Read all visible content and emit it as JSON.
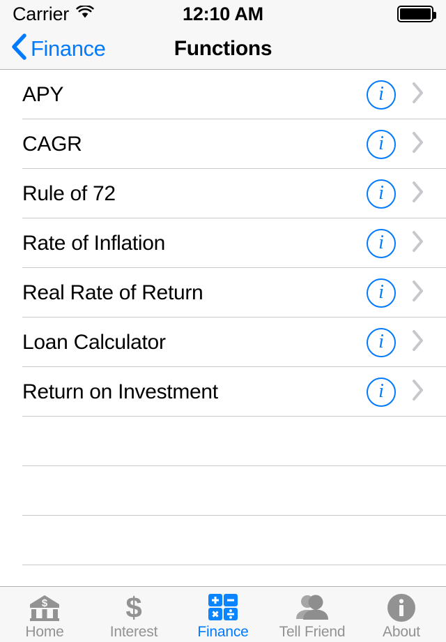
{
  "status_bar": {
    "carrier": "Carrier",
    "wifi_icon": "wifi-icon",
    "time": "12:10 AM",
    "battery_icon": "battery-full-icon",
    "battery_level_percent": 100
  },
  "nav_bar": {
    "back_icon": "chevron-left-icon",
    "back_label": "Finance",
    "title": "Functions",
    "tint_color": "#007aff"
  },
  "list": {
    "rows": [
      {
        "title": "APY",
        "info_icon": "info-circle-icon",
        "disclosure_icon": "chevron-right-icon"
      },
      {
        "title": "CAGR",
        "info_icon": "info-circle-icon",
        "disclosure_icon": "chevron-right-icon"
      },
      {
        "title": "Rule of 72",
        "info_icon": "info-circle-icon",
        "disclosure_icon": "chevron-right-icon"
      },
      {
        "title": "Rate of Inflation",
        "info_icon": "info-circle-icon",
        "disclosure_icon": "chevron-right-icon"
      },
      {
        "title": "Real Rate of Return",
        "info_icon": "info-circle-icon",
        "disclosure_icon": "chevron-right-icon"
      },
      {
        "title": "Loan Calculator",
        "info_icon": "info-circle-icon",
        "disclosure_icon": "chevron-right-icon"
      },
      {
        "title": "Return on Investment",
        "info_icon": "info-circle-icon",
        "disclosure_icon": "chevron-right-icon"
      }
    ],
    "empty_row_count": 3,
    "separator_color": "#c8c7cc"
  },
  "tab_bar": {
    "active_index": 2,
    "active_color": "#007aff",
    "inactive_color": "#929292",
    "items": [
      {
        "label": "Home",
        "icon": "bank-building-icon"
      },
      {
        "label": "Interest",
        "icon": "dollar-sign-icon"
      },
      {
        "label": "Finance",
        "icon": "calculator-icon"
      },
      {
        "label": "Tell Friend",
        "icon": "two-people-icon"
      },
      {
        "label": "About",
        "icon": "info-circle-filled-icon"
      }
    ]
  }
}
